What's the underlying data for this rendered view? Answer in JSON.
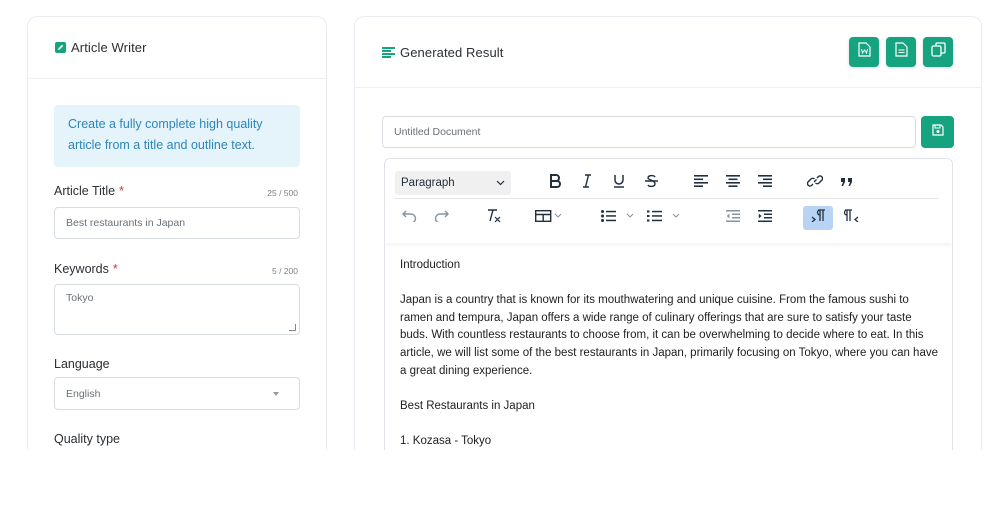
{
  "left_panel": {
    "title": "Article Writer",
    "info": "Create a fully complete high quality article from a title and outline text.",
    "article_title": {
      "label": "Article Title",
      "required_mark": "*",
      "counter": "25 / 500",
      "value": "Best restaurants in Japan"
    },
    "keywords": {
      "label": "Keywords",
      "required_mark": "*",
      "counter": "5 / 200",
      "value": "Tokyo"
    },
    "language": {
      "label": "Language",
      "selected": "English"
    },
    "quality_type": {
      "label": "Quality type"
    }
  },
  "right_panel": {
    "title": "Generated Result",
    "action_icons": [
      "word-doc-icon",
      "text-doc-icon",
      "copy-icon"
    ],
    "document_name": {
      "placeholder": "Untitled Document"
    },
    "toolbar": {
      "block_format": "Paragraph"
    },
    "content": {
      "p1": "Introduction",
      "p2": "Japan is a country that is known for its mouthwatering and unique cuisine. From the famous sushi to ramen and tempura, Japan offers a wide range of culinary offerings that are sure to satisfy your taste buds. With countless restaurants to choose from, it can be overwhelming to decide where to eat. In this article, we will list some of the best restaurants in Japan, primarily focusing on Tokyo, where you can have a great dining experience.",
      "p3": "Best Restaurants in Japan",
      "p4": "1. Kozasa - Tokyo"
    }
  },
  "colors": {
    "accent": "#16a37f",
    "info_bg": "#e5f3fb",
    "info_text": "#2e86b6",
    "required": "#e03131"
  }
}
